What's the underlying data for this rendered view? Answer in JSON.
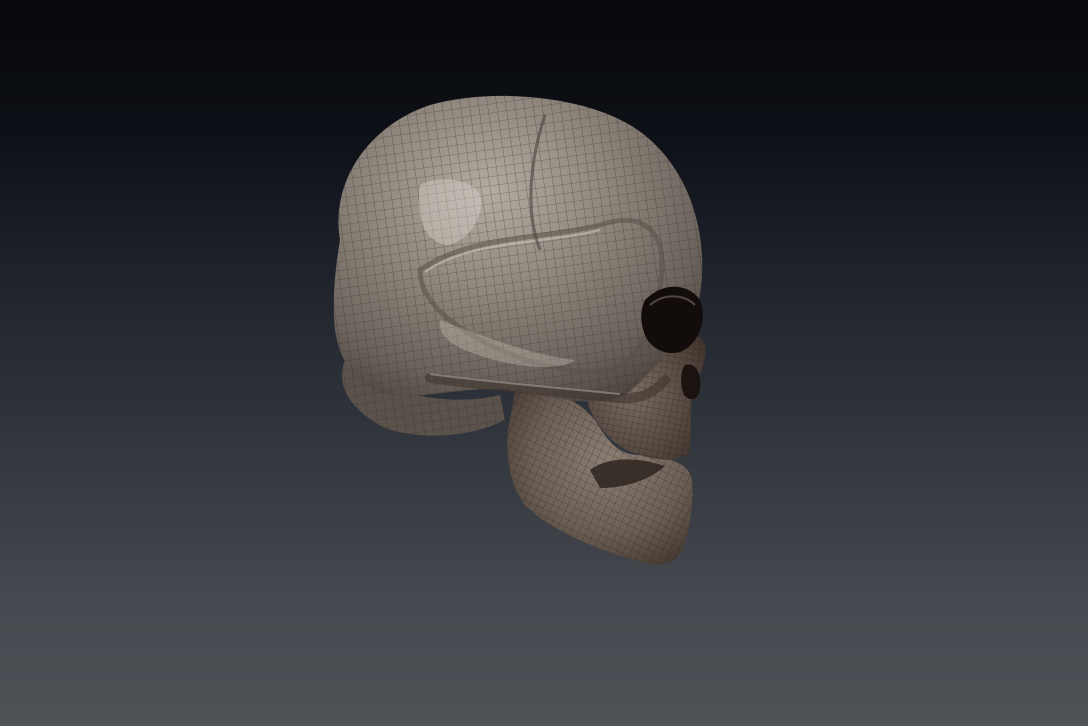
{
  "viewport": {
    "description_label": "",
    "background_top": "#07080c",
    "background_bottom": "#4f5257"
  },
  "model": {
    "icon": "skull-wireframe-mesh",
    "material_color": "#8a7f76",
    "wire_color": "#2a2420",
    "shadow_color": "#3b322d",
    "highlight_color": "#cbc2b8"
  }
}
